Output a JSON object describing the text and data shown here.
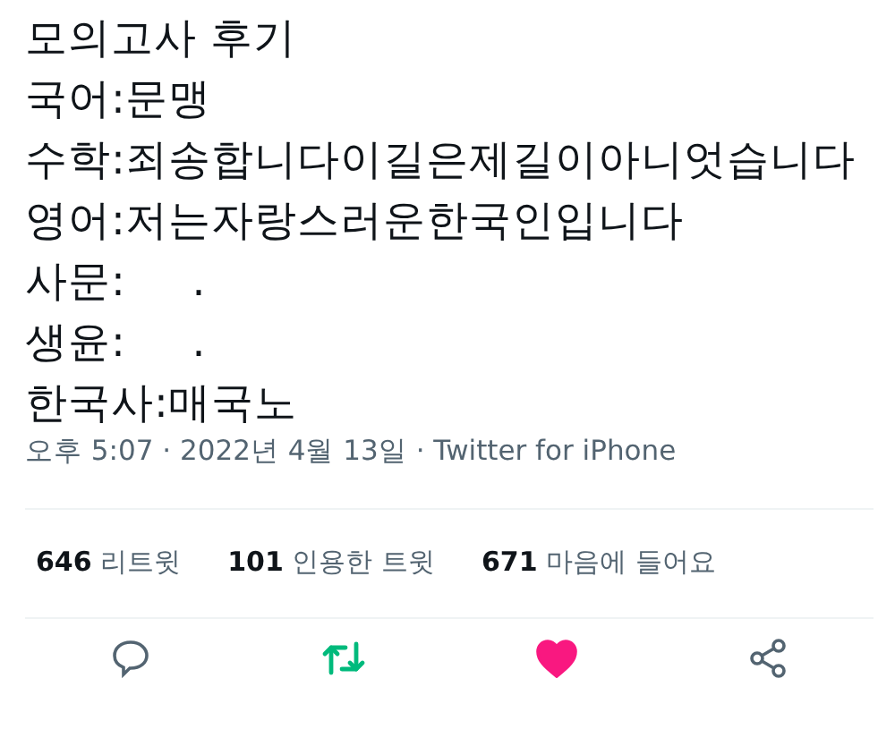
{
  "tweet": {
    "lines": [
      "모의고사 후기",
      "국어:문맹",
      "수학:죄송합니다이길은제길이아니엇습니다",
      "영어:저는자랑스러운한국인입니다",
      "사문:     .",
      "생윤:     .",
      "한국사:매국노"
    ],
    "meta": "오후 5:07 · 2022년 4월 13일 · Twitter for iPhone",
    "stats": [
      {
        "count": "646",
        "label": "리트윗"
      },
      {
        "count": "101",
        "label": "인용한 트윗"
      },
      {
        "count": "671",
        "label": "마음에 들어요"
      }
    ],
    "actions": [
      {
        "kind": "reply",
        "on": false
      },
      {
        "kind": "retweet",
        "on": true
      },
      {
        "kind": "like",
        "on": true
      },
      {
        "kind": "share",
        "on": false
      }
    ]
  }
}
